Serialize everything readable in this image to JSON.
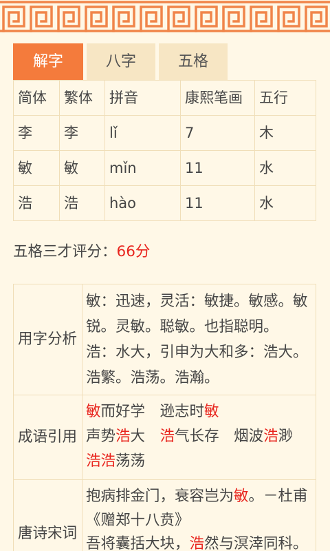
{
  "colors": {
    "page_background": "#FFF8E7",
    "accent": "#F47B3C",
    "tab_inactive": "#F7E6C4",
    "border": "#F0DEB8",
    "text": "#454545",
    "highlight": "#E8251E",
    "pattern": "#F0854A"
  },
  "tabs": [
    {
      "label": "解字",
      "active": true
    },
    {
      "label": "八字",
      "active": false
    },
    {
      "label": "五格",
      "active": false
    }
  ],
  "char_table": {
    "headers": [
      "简体",
      "繁体",
      "拼音",
      "康熙笔画",
      "五行"
    ],
    "rows": [
      [
        "李",
        "李",
        "lǐ",
        "7",
        "木"
      ],
      [
        "敏",
        "敏",
        "mǐn",
        "11",
        "水"
      ],
      [
        "浩",
        "浩",
        "hào",
        "11",
        "水"
      ]
    ]
  },
  "score": {
    "label": "五格三才评分：",
    "value": "66分"
  },
  "details": {
    "char_analysis": {
      "label": "用字分析",
      "paragraphs": [
        "敏：迅速，灵活：敏捷。敏感。敏锐。灵敏。聪敏。也指聪明。",
        "浩：水大，引申为大和多：浩大。浩繁。浩荡。浩瀚。"
      ]
    },
    "idioms": {
      "label": "成语引用",
      "groups": [
        [
          {
            "hl": "敏",
            "post": "而好学"
          },
          {
            "pre": "逊志时",
            "hl": "敏"
          }
        ],
        [
          {
            "pre": "声势",
            "hl": "浩",
            "post": "大"
          },
          {
            "hl": "浩",
            "post": "气长存"
          },
          {
            "pre": "烟波",
            "hl": "浩",
            "post": "渺"
          },
          {
            "hl": "浩浩",
            "post": "荡荡"
          }
        ]
      ]
    },
    "poems": {
      "label": "唐诗宋词",
      "lines": [
        {
          "pre": "抱病排金门，衰容岂为",
          "hl": "敏",
          "post": "。－杜甫《赠郑十八贲》"
        },
        {
          "pre": "吾将囊括大块，",
          "hl": "浩",
          "post": "然与溟涬同科。"
        }
      ]
    }
  }
}
